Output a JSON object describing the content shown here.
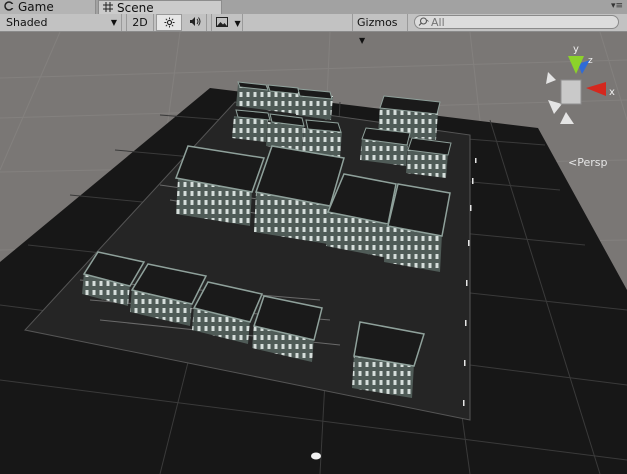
{
  "tabs": [
    {
      "label": "Game",
      "icon": "game-controller-icon"
    },
    {
      "label": "Scene",
      "icon": "scene-grid-icon"
    }
  ],
  "toolbar": {
    "draw_mode": "Shaded",
    "mode_2d": "2D",
    "gizmos_label": "Gizmos",
    "search": {
      "value": "",
      "placeholder": "All"
    }
  },
  "gizmo": {
    "y_label": "y",
    "x_label": "x",
    "z_label": "z",
    "projection_label": "Persp"
  },
  "colors": {
    "background": "#7a7775",
    "ground": "#161616",
    "building_roof": "#1a1a1a",
    "building_wall": "#55605c",
    "axis_x": "#d4281e",
    "axis_y": "#8cd22a",
    "axis_z": "#2f6bd6"
  }
}
